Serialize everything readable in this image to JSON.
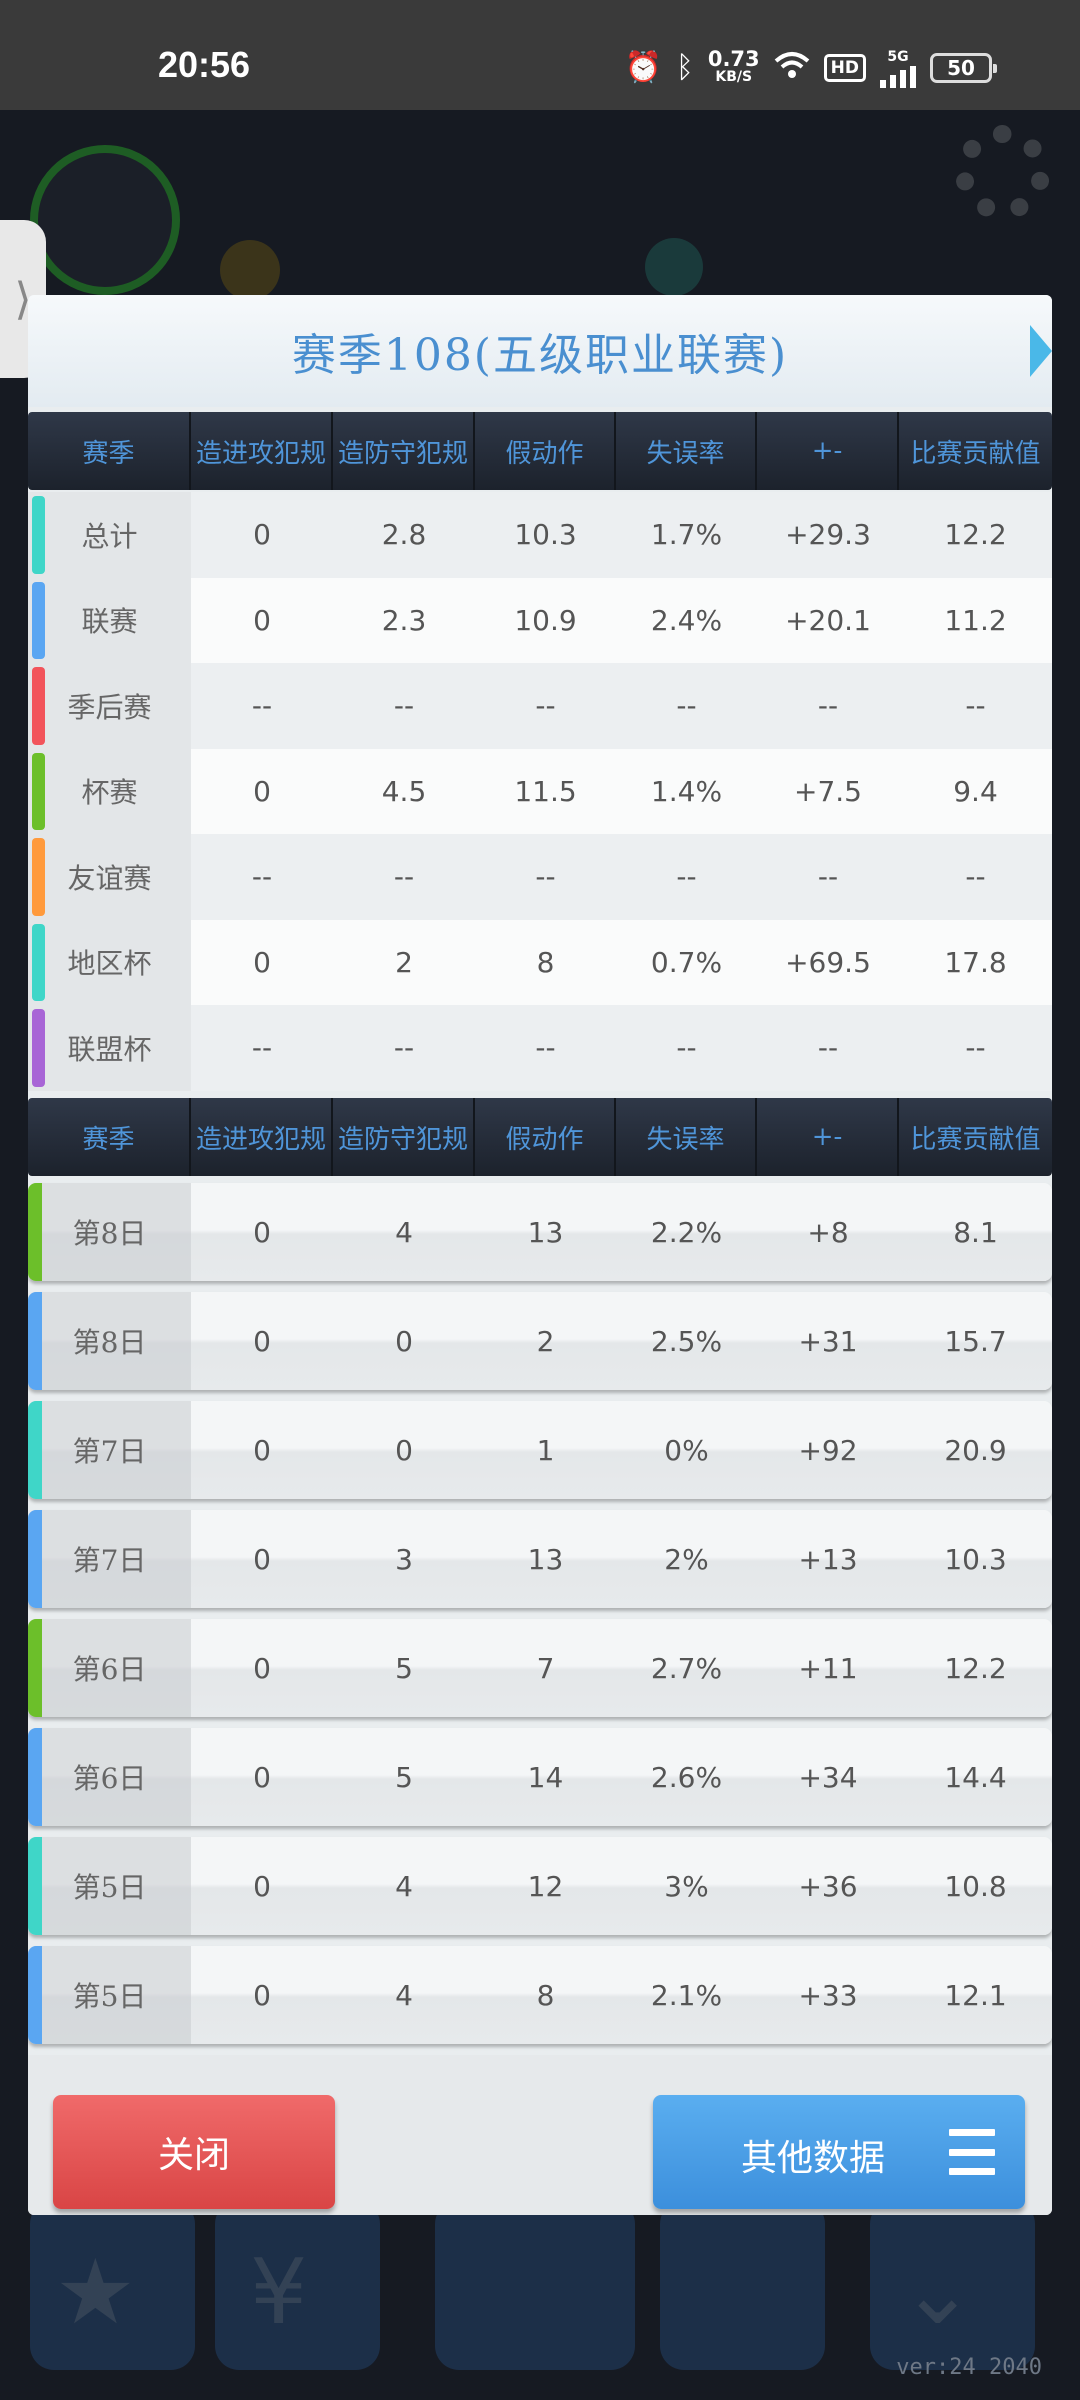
{
  "status_bar": {
    "time": "20:56",
    "net_speed_value": "0.73",
    "net_speed_unit": "KB/S",
    "hd": "HD",
    "signal": "5G",
    "battery": "50"
  },
  "side_tab_glyph": "⟩",
  "dialog": {
    "title": "赛季108(五级职业联赛)",
    "columns": [
      "赛季",
      "造进攻犯规",
      "造防守犯规",
      "假动作",
      "失误率",
      "+-",
      "比赛贡献值"
    ],
    "summary_rows": [
      {
        "label": "总计",
        "color": "#3fd6c8",
        "values": [
          "0",
          "2.8",
          "10.3",
          "1.7%",
          "+29.3",
          "12.2"
        ]
      },
      {
        "label": "联赛",
        "color": "#5aa6f2",
        "values": [
          "0",
          "2.3",
          "10.9",
          "2.4%",
          "+20.1",
          "11.2"
        ]
      },
      {
        "label": "季后赛",
        "color": "#f2545b",
        "values": [
          "--",
          "--",
          "--",
          "--",
          "--",
          "--"
        ]
      },
      {
        "label": "杯赛",
        "color": "#6cbf2a",
        "values": [
          "0",
          "4.5",
          "11.5",
          "1.4%",
          "+7.5",
          "9.4"
        ]
      },
      {
        "label": "友谊赛",
        "color": "#ff9a3c",
        "values": [
          "--",
          "--",
          "--",
          "--",
          "--",
          "--"
        ]
      },
      {
        "label": "地区杯",
        "color": "#3fd6c8",
        "values": [
          "0",
          "2",
          "8",
          "0.7%",
          "+69.5",
          "17.8"
        ]
      },
      {
        "label": "联盟杯",
        "color": "#a865d6",
        "values": [
          "--",
          "--",
          "--",
          "--",
          "--",
          "--"
        ]
      }
    ],
    "match_rows": [
      {
        "label": "第8日",
        "color": "#6cbf2a",
        "values": [
          "0",
          "4",
          "13",
          "2.2%",
          "+8",
          "8.1"
        ]
      },
      {
        "label": "第8日",
        "color": "#5aa6f2",
        "values": [
          "0",
          "0",
          "2",
          "2.5%",
          "+31",
          "15.7"
        ]
      },
      {
        "label": "第7日",
        "color": "#3fd6c8",
        "values": [
          "0",
          "0",
          "1",
          "0%",
          "+92",
          "20.9"
        ]
      },
      {
        "label": "第7日",
        "color": "#5aa6f2",
        "values": [
          "0",
          "3",
          "13",
          "2%",
          "+13",
          "10.3"
        ]
      },
      {
        "label": "第6日",
        "color": "#6cbf2a",
        "values": [
          "0",
          "5",
          "7",
          "2.7%",
          "+11",
          "12.2"
        ]
      },
      {
        "label": "第6日",
        "color": "#5aa6f2",
        "values": [
          "0",
          "5",
          "14",
          "2.6%",
          "+34",
          "14.4"
        ]
      },
      {
        "label": "第5日",
        "color": "#3fd6c8",
        "values": [
          "0",
          "4",
          "12",
          "3%",
          "+36",
          "10.8"
        ]
      },
      {
        "label": "第5日",
        "color": "#5aa6f2",
        "values": [
          "0",
          "4",
          "8",
          "2.1%",
          "+33",
          "12.1"
        ]
      }
    ],
    "close_label": "关闭",
    "other_label": "其他数据"
  },
  "version": "ver:24 2040"
}
